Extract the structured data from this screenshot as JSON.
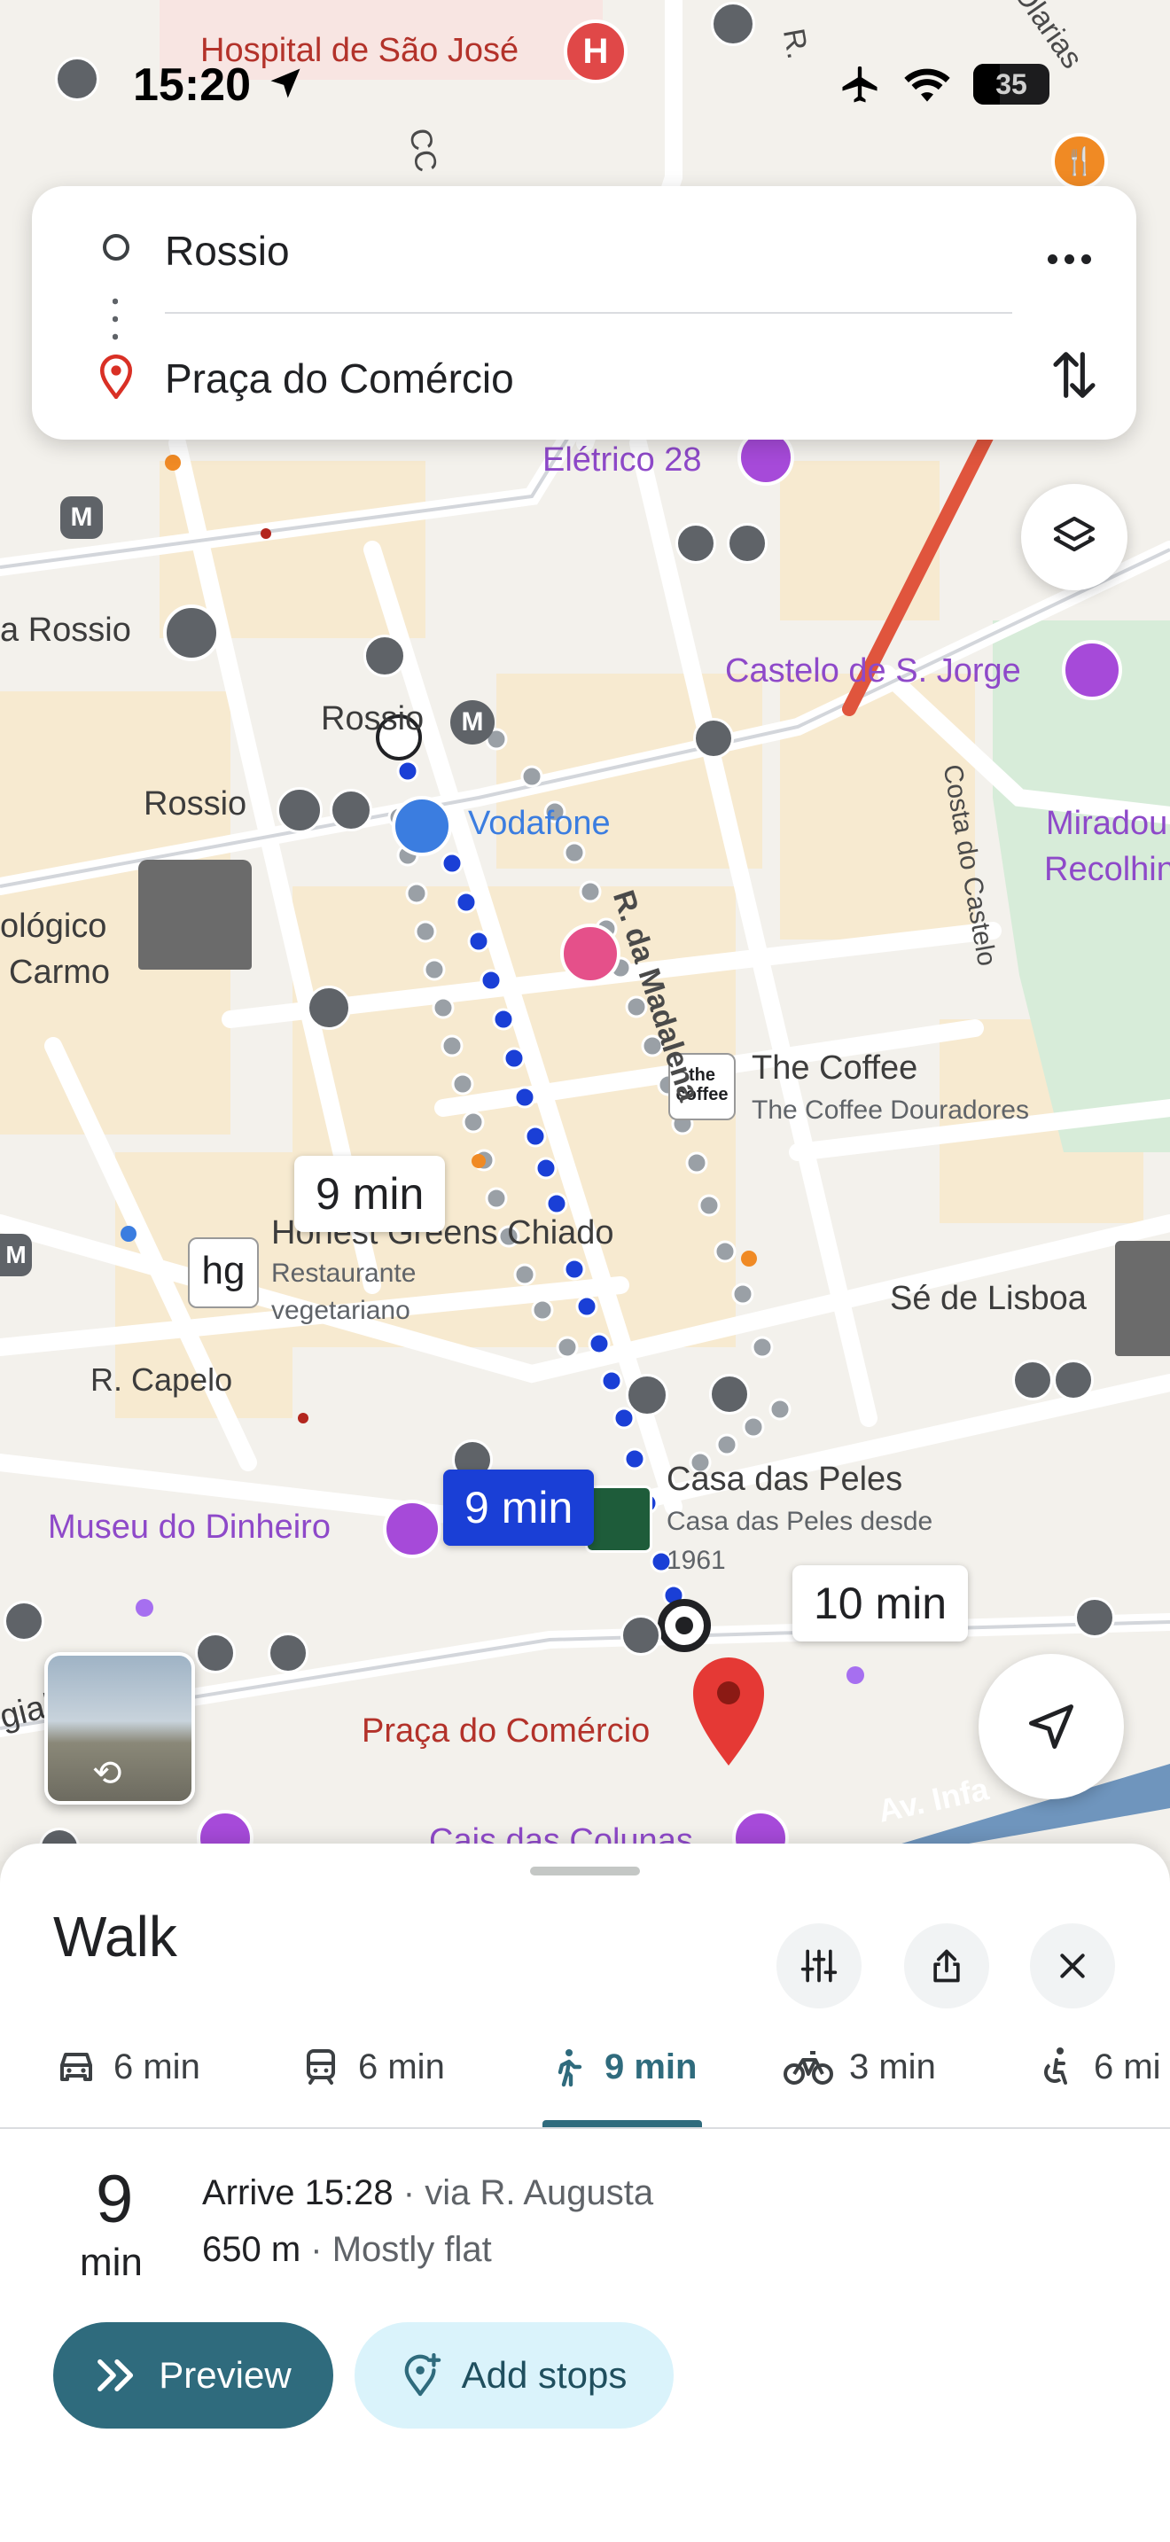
{
  "status": {
    "time": "15:20",
    "battery": "35"
  },
  "search": {
    "origin": "Rossio",
    "destination": "Praça do Comércio"
  },
  "map": {
    "labels": {
      "hospital": "Hospital de São José",
      "eletrico": "Elétrico 28",
      "rossio_left": "a Rossio",
      "rossio_station": "Rossio",
      "rossio_top": "Rossio",
      "vodafone": "Vodafone",
      "castelo": "Castelo de S. Jorge",
      "miradouro": "Miradou",
      "recolhimento": "Recolhin",
      "ologico": "ológico",
      "carmo": "Carmo",
      "madalena": "R. da Madalena",
      "costa_castelo": "Costa do Castelo",
      "coffee": "The Coffee",
      "coffee_sub": "The Coffee Douradores",
      "honest": "Honest Greens Chiado",
      "honest_sub1": "Restaurante",
      "honest_sub2": "vegetariano",
      "se": "Sé de Lisboa",
      "capelo": "R. Capelo",
      "casa": "Casa das Peles",
      "casa_sub1": "Casa das Peles desde",
      "casa_sub2": "1961",
      "museu": "Museu do Dinheiro",
      "praca": "Praça do Comércio",
      "cais": "Cais das Colunas",
      "av": "Av. Infa",
      "cc": "CC",
      "olarias": "Olarias",
      "r_top": "R.",
      "gial": "gial"
    },
    "route_times": {
      "alt_left": "9 min",
      "selected": "9 min",
      "alt_right": "10 min"
    }
  },
  "sheet": {
    "title": "Walk",
    "modes": [
      {
        "icon": "car-icon",
        "label": "6 min"
      },
      {
        "icon": "transit-icon",
        "label": "6 min"
      },
      {
        "icon": "walk-icon",
        "label": "9 min"
      },
      {
        "icon": "bike-icon",
        "label": "3 min"
      },
      {
        "icon": "wheelchair-icon",
        "label": "6 mi"
      }
    ],
    "duration_number": "9",
    "duration_unit": "min",
    "arrive": "Arrive 15:28",
    "via": " · via R. Augusta",
    "distance": "650 m",
    "terrain": " · Mostly flat",
    "preview_label": "Preview",
    "add_stops_label": "Add stops"
  },
  "colors": {
    "route_blue": "#1a3fd6",
    "accent_teal": "#2f6b7d",
    "annotation_red": "#e0553d"
  }
}
